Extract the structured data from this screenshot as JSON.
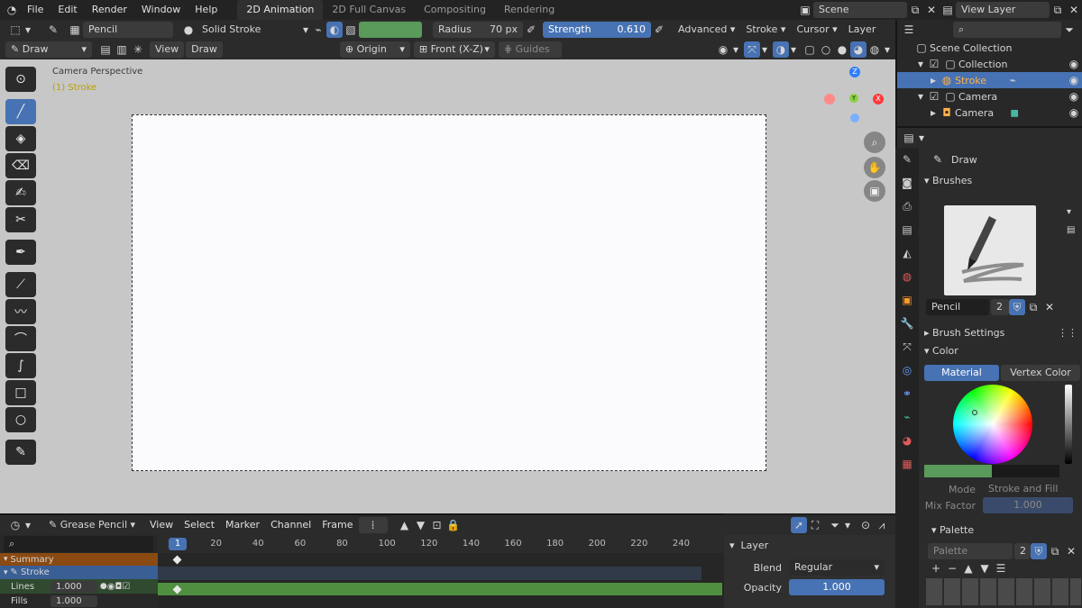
{
  "menu": {
    "items": [
      "File",
      "Edit",
      "Render",
      "Window",
      "Help"
    ],
    "workspaces": [
      "2D Animation",
      "2D Full Canvas",
      "Compositing",
      "Rendering"
    ],
    "active_workspace": 0,
    "scene": "Scene",
    "view_layer": "View Layer"
  },
  "toolheader": {
    "brush_name": "Pencil",
    "stroke_type": "Solid Stroke",
    "radius_label": "Radius",
    "radius_value": "70 px",
    "strength_label": "Strength",
    "strength_value": "0.610",
    "advanced": "Advanced",
    "stroke": "Stroke",
    "cursor": "Cursor",
    "layer": "Layer"
  },
  "header2": {
    "mode": "Draw",
    "view": "View",
    "draw": "Draw",
    "origin": "Origin",
    "plane": "Front (X-Z)",
    "guides": "Guides"
  },
  "viewport": {
    "perspective": "Camera Perspective",
    "object": "(1) Stroke"
  },
  "outliner": {
    "title": "Scene Collection",
    "items": [
      {
        "label": "Collection",
        "indent": 1
      },
      {
        "label": "Stroke",
        "indent": 2,
        "selected": true
      },
      {
        "label": "Camera",
        "indent": 1
      },
      {
        "label": "Camera",
        "indent": 2
      }
    ]
  },
  "props": {
    "tool": "Draw",
    "brushes": "Brushes",
    "brush_field": "Pencil",
    "brush_users": "2",
    "brush_settings": "Brush Settings",
    "color": "Color",
    "material_tab": "Material",
    "vertex_tab": "Vertex Color",
    "mode_label": "Mode",
    "mode_value": "Stroke and Fill",
    "mix_label": "Mix Factor",
    "mix_value": "1.000",
    "palette": "Palette",
    "palette_field": "Palette",
    "palette_users": "2"
  },
  "timeline": {
    "mode": "Grease Pencil",
    "menus": [
      "View",
      "Select",
      "Marker",
      "Channel",
      "Frame"
    ],
    "current_frame": "1",
    "ticks": [
      "20",
      "40",
      "60",
      "80",
      "100",
      "120",
      "140",
      "160",
      "180",
      "200",
      "220",
      "240"
    ],
    "channels": [
      {
        "label": "Summary"
      },
      {
        "label": "Stroke"
      },
      {
        "label": "Lines",
        "value": "1.000"
      },
      {
        "label": "Fills",
        "value": "1.000"
      }
    ]
  },
  "layer": {
    "title": "Layer",
    "blend_label": "Blend",
    "blend_value": "Regular",
    "opacity_label": "Opacity",
    "opacity_value": "1.000"
  },
  "colors": {
    "accent": "#4772b3",
    "stroke_color": "#5a9a5a",
    "keyframe_bar": "#4f8f3f"
  }
}
